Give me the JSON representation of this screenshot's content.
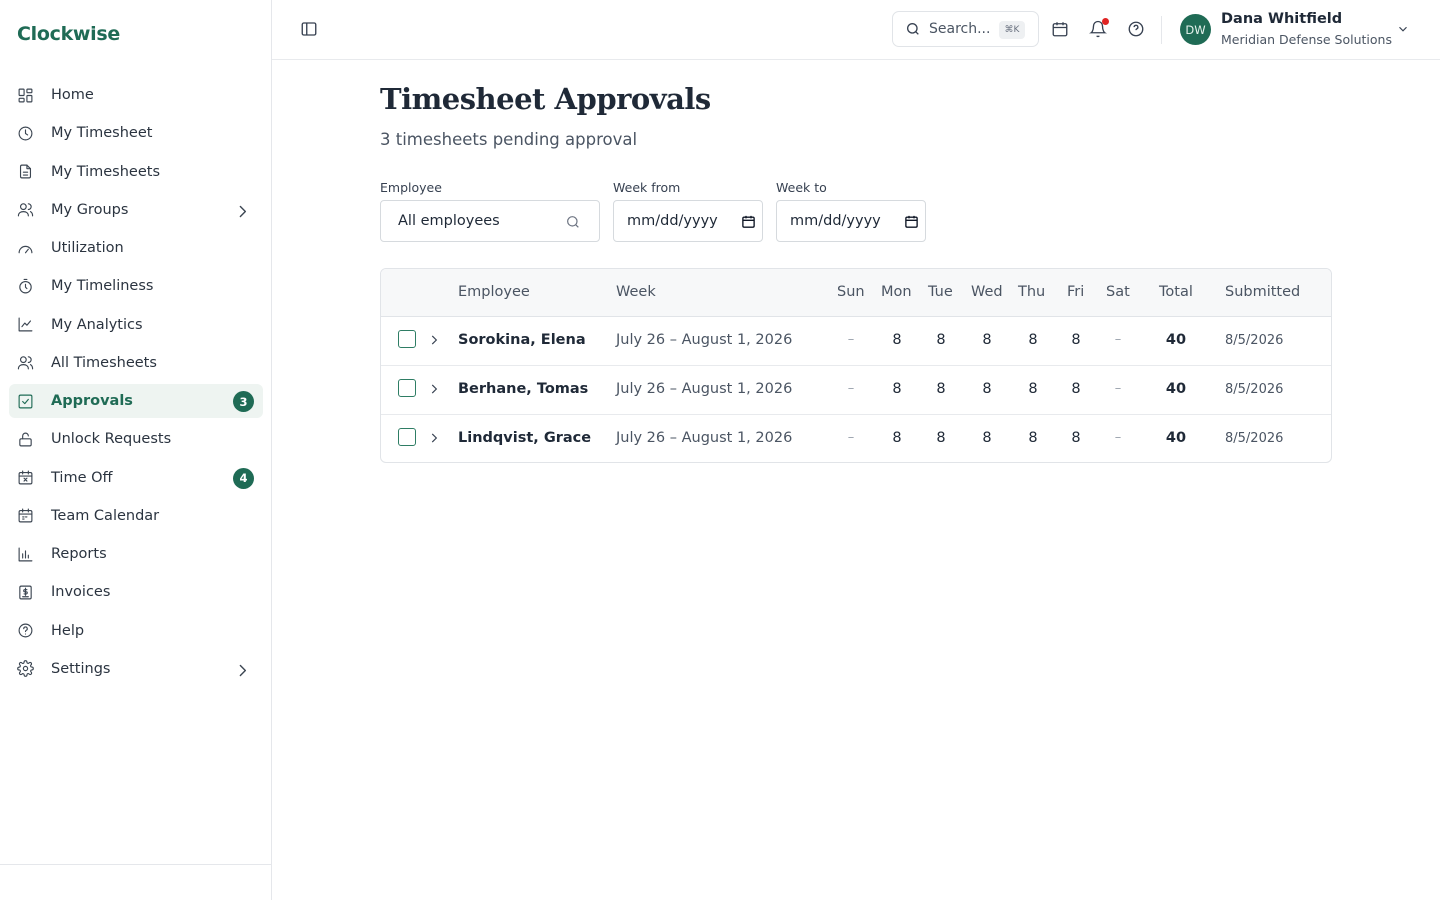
{
  "app": {
    "name": "Clockwise"
  },
  "sidebar": {
    "items": [
      {
        "label": "Home",
        "icon": "grid-icon"
      },
      {
        "label": "My Timesheet",
        "icon": "clock-icon"
      },
      {
        "label": "My Timesheets",
        "icon": "document-icon"
      },
      {
        "label": "My Groups",
        "icon": "users-icon"
      },
      {
        "label": "Utilization",
        "icon": "gauge-icon"
      },
      {
        "label": "My Timeliness",
        "icon": "stopwatch-icon"
      },
      {
        "label": "My Analytics",
        "icon": "line-chart-icon"
      },
      {
        "label": "All Timesheets",
        "icon": "users-icon"
      },
      {
        "label": "Approvals",
        "icon": "check-square-icon",
        "badge": "3",
        "active": true
      },
      {
        "label": "Unlock Requests",
        "icon": "unlock-icon"
      },
      {
        "label": "Time Off",
        "icon": "calendar-x-icon",
        "badge": "4"
      },
      {
        "label": "Team Calendar",
        "icon": "calendar-icon"
      },
      {
        "label": "Reports",
        "icon": "bar-chart-icon"
      },
      {
        "label": "Invoices",
        "icon": "dollar-document-icon"
      },
      {
        "label": "Help",
        "icon": "help-circle-icon"
      },
      {
        "label": "Settings",
        "icon": "gear-icon"
      }
    ]
  },
  "topbar": {
    "search_placeholder": "Search...",
    "search_shortcut": "⌘K",
    "user": {
      "initials": "DW",
      "name": "Dana Whitfield",
      "org": "Meridian Defense Solutions"
    }
  },
  "page": {
    "title": "Timesheet Approvals",
    "subtitle": "3 timesheets pending approval"
  },
  "filters": {
    "employee_label": "Employee",
    "employee_value": "All employees",
    "week_from_label": "Week from",
    "week_from_value": "mm/dd/yyyy",
    "week_to_label": "Week to",
    "week_to_value": "mm/dd/yyyy"
  },
  "table": {
    "headers": {
      "employee": "Employee",
      "week": "Week",
      "sun": "Sun",
      "mon": "Mon",
      "tue": "Tue",
      "wed": "Wed",
      "thu": "Thu",
      "fri": "Fri",
      "sat": "Sat",
      "total": "Total",
      "submitted": "Submitted"
    },
    "rows": [
      {
        "employee": "Sorokina, Elena",
        "week": "July 26 – August 1, 2026",
        "sun": "–",
        "mon": "8",
        "tue": "8",
        "wed": "8",
        "thu": "8",
        "fri": "8",
        "sat": "–",
        "total": "40",
        "submitted": "8/5/2026"
      },
      {
        "employee": "Berhane, Tomas",
        "week": "July 26 – August 1, 2026",
        "sun": "–",
        "mon": "8",
        "tue": "8",
        "wed": "8",
        "thu": "8",
        "fri": "8",
        "sat": "–",
        "total": "40",
        "submitted": "8/5/2026"
      },
      {
        "employee": "Lindqvist, Grace",
        "week": "July 26 – August 1, 2026",
        "sun": "–",
        "mon": "8",
        "tue": "8",
        "wed": "8",
        "thu": "8",
        "fri": "8",
        "sat": "–",
        "total": "40",
        "submitted": "8/5/2026"
      }
    ]
  },
  "colors": {
    "brand": "#1f6b55",
    "notification": "#e02424"
  }
}
